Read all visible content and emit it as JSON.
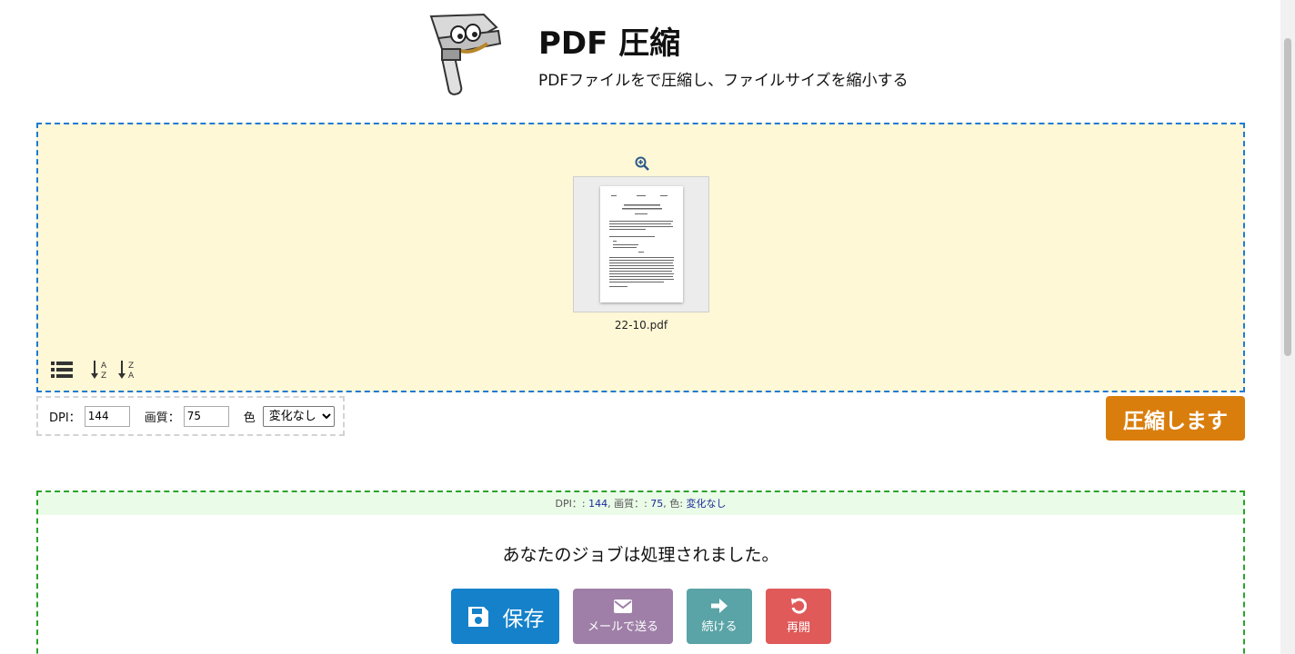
{
  "header": {
    "title": "PDF 圧縮",
    "subtitle": "PDFファイルをで圧縮し、ファイルサイズを縮小する"
  },
  "dropzone": {
    "file_name": "22-10.pdf"
  },
  "options": {
    "dpi_label": "DPI：",
    "dpi_value": "144",
    "quality_label": "画質：",
    "quality_value": "75",
    "color_label": "色",
    "color_selected": "変化なし"
  },
  "compress_button": "圧縮します",
  "result": {
    "dpi_label": "DPI：: ",
    "dpi_value": "144",
    "quality_label": ", 画質：: ",
    "quality_value": "75",
    "color_label": ", 色: ",
    "color_value": "変化なし",
    "message": "あなたのジョブは処理されました。",
    "save_label": "保存",
    "mail_label": "メールで送る",
    "continue_label": "続ける",
    "reset_label": "再開"
  },
  "colors": {
    "accent_blue": "#1481ca",
    "compress_orange": "#d97e0d",
    "dropzone_bg": "#fff8d6",
    "result_border": "#2aa42a"
  }
}
